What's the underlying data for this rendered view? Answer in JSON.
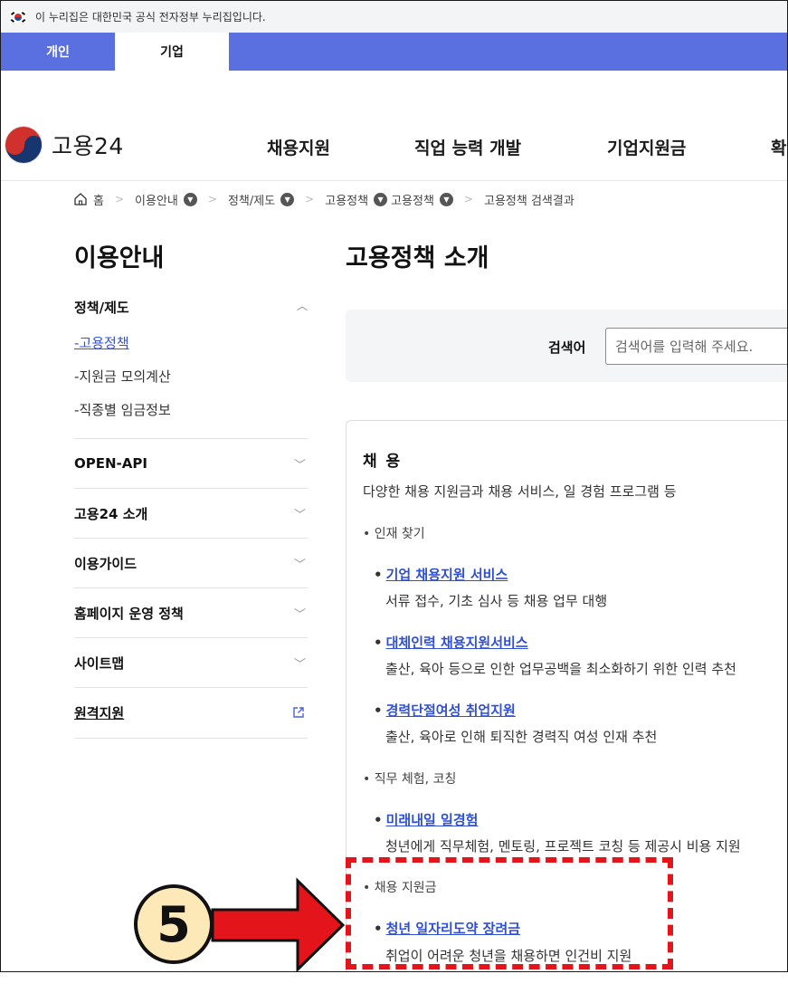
{
  "gov_banner": {
    "text": "이 누리집은 대한민국 공식 전자정부 누리집입니다."
  },
  "tabs": [
    {
      "label": "개인",
      "active": false
    },
    {
      "label": "기업",
      "active": true
    }
  ],
  "header": {
    "logo_text": "고용24",
    "nav": [
      "채용지원",
      "직업 능력 개발",
      "기업지원금",
      "확"
    ]
  },
  "breadcrumb": {
    "home": "홈",
    "items": [
      "이용안내",
      "정책/제도",
      "고용정책",
      "고용정책",
      "고용정책 검색결과"
    ]
  },
  "sidebar": {
    "title": "이용안내",
    "group": {
      "label": "정책/제도",
      "subs": [
        "-고용정책",
        "-지원금 모의계산",
        "-직종별 임금정보"
      ]
    },
    "items": [
      "OPEN-API",
      "고용24 소개",
      "이용가이드",
      "홈페이지 운영 정책",
      "사이트맵",
      "원격지원"
    ]
  },
  "main": {
    "title": "고용정책 소개",
    "search": {
      "label": "검색어",
      "placeholder": "검색어를 입력해 주세요."
    },
    "card": {
      "title": "채 용",
      "desc": "다양한 채용 지원금과 채용 서비스, 일 경험 프로그램 등",
      "categories": [
        "• 인재 찾기",
        "• 직무 체험, 코칭",
        "• 채용 지원금"
      ],
      "links": [
        {
          "title": "기업 채용지원 서비스",
          "desc": "서류 접수, 기초 심사 등 채용 업무 대행"
        },
        {
          "title": "대체인력 채용지원서비스",
          "desc": "출산, 육아 등으로 인한 업무공백을 최소화하기 위한 인력 추천"
        },
        {
          "title": "경력단절여성 취업지원",
          "desc": "출산, 육아로 인해 퇴직한 경력직 여성 인재 추천"
        },
        {
          "title": "미래내일 일경험",
          "desc": "청년에게 직무체험, 멘토링, 프로젝트 코칭 등 제공시 비용 지원"
        },
        {
          "title": "청년 일자리도약 장려금",
          "desc": "취업이 어려운 청년을 채용하면 인건비 지원"
        }
      ]
    }
  },
  "annotation": {
    "step": "5",
    "color": "#e3141a"
  }
}
